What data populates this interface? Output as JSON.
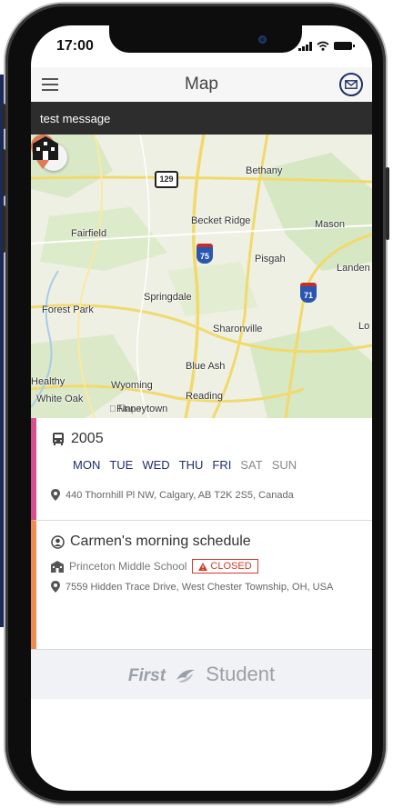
{
  "status_bar": {
    "time": "17:00"
  },
  "app_bar": {
    "title": "Map",
    "menu_icon": "hamburger-icon",
    "mail_icon": "envelope-icon"
  },
  "message_bar": {
    "text": "test message"
  },
  "map": {
    "labels": [
      "Bethany",
      "Becket Ridge",
      "Mason",
      "Fairfield",
      "Pisgah",
      "Landen",
      "Springdale",
      "Forest Park",
      "Sharonville",
      "Lo",
      "Blue Ash",
      "Healthy",
      "Wyoming",
      "White Oak",
      "Reading",
      "Finneytown"
    ],
    "route_shields": [
      "129",
      "75",
      "71"
    ],
    "legal": "Maps"
  },
  "cards": [
    {
      "icon": "bus-icon",
      "title": "2005",
      "days": [
        {
          "label": "MON",
          "active": true
        },
        {
          "label": "TUE",
          "active": true
        },
        {
          "label": "WED",
          "active": true
        },
        {
          "label": "THU",
          "active": true
        },
        {
          "label": "FRI",
          "active": true
        },
        {
          "label": "SAT",
          "active": false
        },
        {
          "label": "SUN",
          "active": false
        }
      ],
      "address_icon": "location-pin-icon",
      "address": "440 Thornhill Pl NW, Calgary, AB T2K 2S5, Canada",
      "accent": "#d84f8e"
    },
    {
      "icon": "person-icon",
      "title": "Carmen's morning schedule",
      "school_icon": "school-icon",
      "school": "Princeton Middle School",
      "status": "CLOSED",
      "address_icon": "location-pin-icon",
      "address": "7559 Hidden Trace Drive, West Chester Township, OH, USA",
      "accent": "#ef8c4f"
    }
  ],
  "footer": {
    "brand_first": "First",
    "brand_second": "Student"
  },
  "colors": {
    "accent_blue": "#1e2f66",
    "closed_red": "#d23b2a"
  }
}
